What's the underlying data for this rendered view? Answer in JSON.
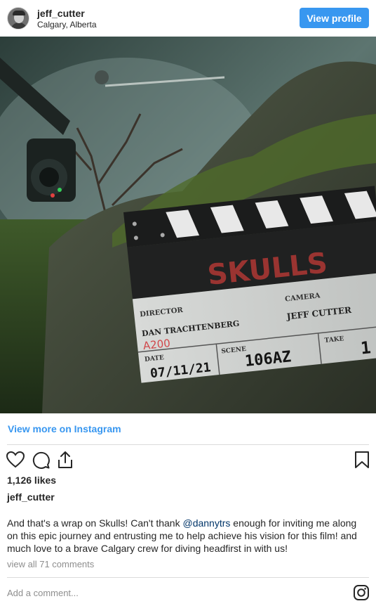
{
  "header": {
    "username": "jeff_cutter",
    "location": "Calgary, Alberta",
    "view_profile_label": "View profile"
  },
  "photo": {
    "clapper_title": "SKULLS",
    "director_label": "DIRECTOR",
    "director_name": "DAN TRACHTENBERG",
    "camera_label": "CAMERA",
    "camera_name": "JEFF CUTTER",
    "roll": "A200",
    "date_label": "DATE",
    "date_value": "07/11/21",
    "scene_label": "SCENE",
    "scene_value": "106AZ",
    "take_label": "TAKE",
    "take_value": "1"
  },
  "view_more_label": "View more on Instagram",
  "actions": {
    "icons": [
      "heart-icon",
      "comment-icon",
      "share-icon",
      "bookmark-icon"
    ]
  },
  "likes": "1,126 likes",
  "caption": {
    "username": "jeff_cutter",
    "text_before": "And that's a wrap on Skulls! Can't thank ",
    "mention": "@dannytrs",
    "text_after": " enough for inviting me along on this epic journey and entrusting me to help achieve his vision for this film! and much love to a brave Calgary crew for diving headfirst in with us!"
  },
  "view_all_comments": "view all 71 comments",
  "add_comment_placeholder": "Add a comment...",
  "colors": {
    "accent": "#3897f0",
    "text": "#262626",
    "muted": "#8e8e8e",
    "border": "#dbdbdb"
  }
}
